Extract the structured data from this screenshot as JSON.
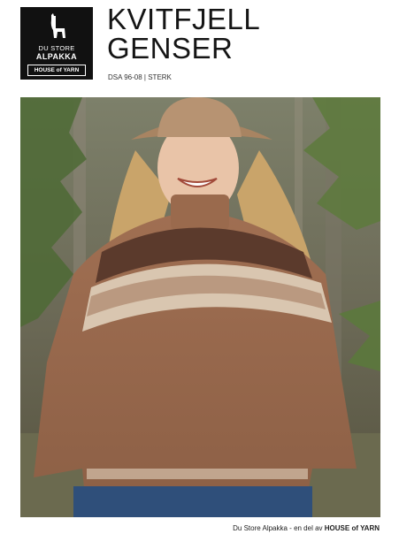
{
  "brand": {
    "line1": "DU STORE",
    "line2": "ALPAKKA",
    "line3": "HOUSE of YARN"
  },
  "pattern": {
    "title_line1": "KVITFJELL",
    "title_line2": "GENSER",
    "code": "DSA 96-08 | STERK"
  },
  "footer": {
    "prefix": "Du Store Alpakka - en del av",
    "brand": "HOUSE of YARN"
  },
  "colors": {
    "sweater": "#9a6b4e",
    "yoke_band": "#5b3a2c",
    "hat": "#b08b6a",
    "forest": "#6f7a55"
  }
}
